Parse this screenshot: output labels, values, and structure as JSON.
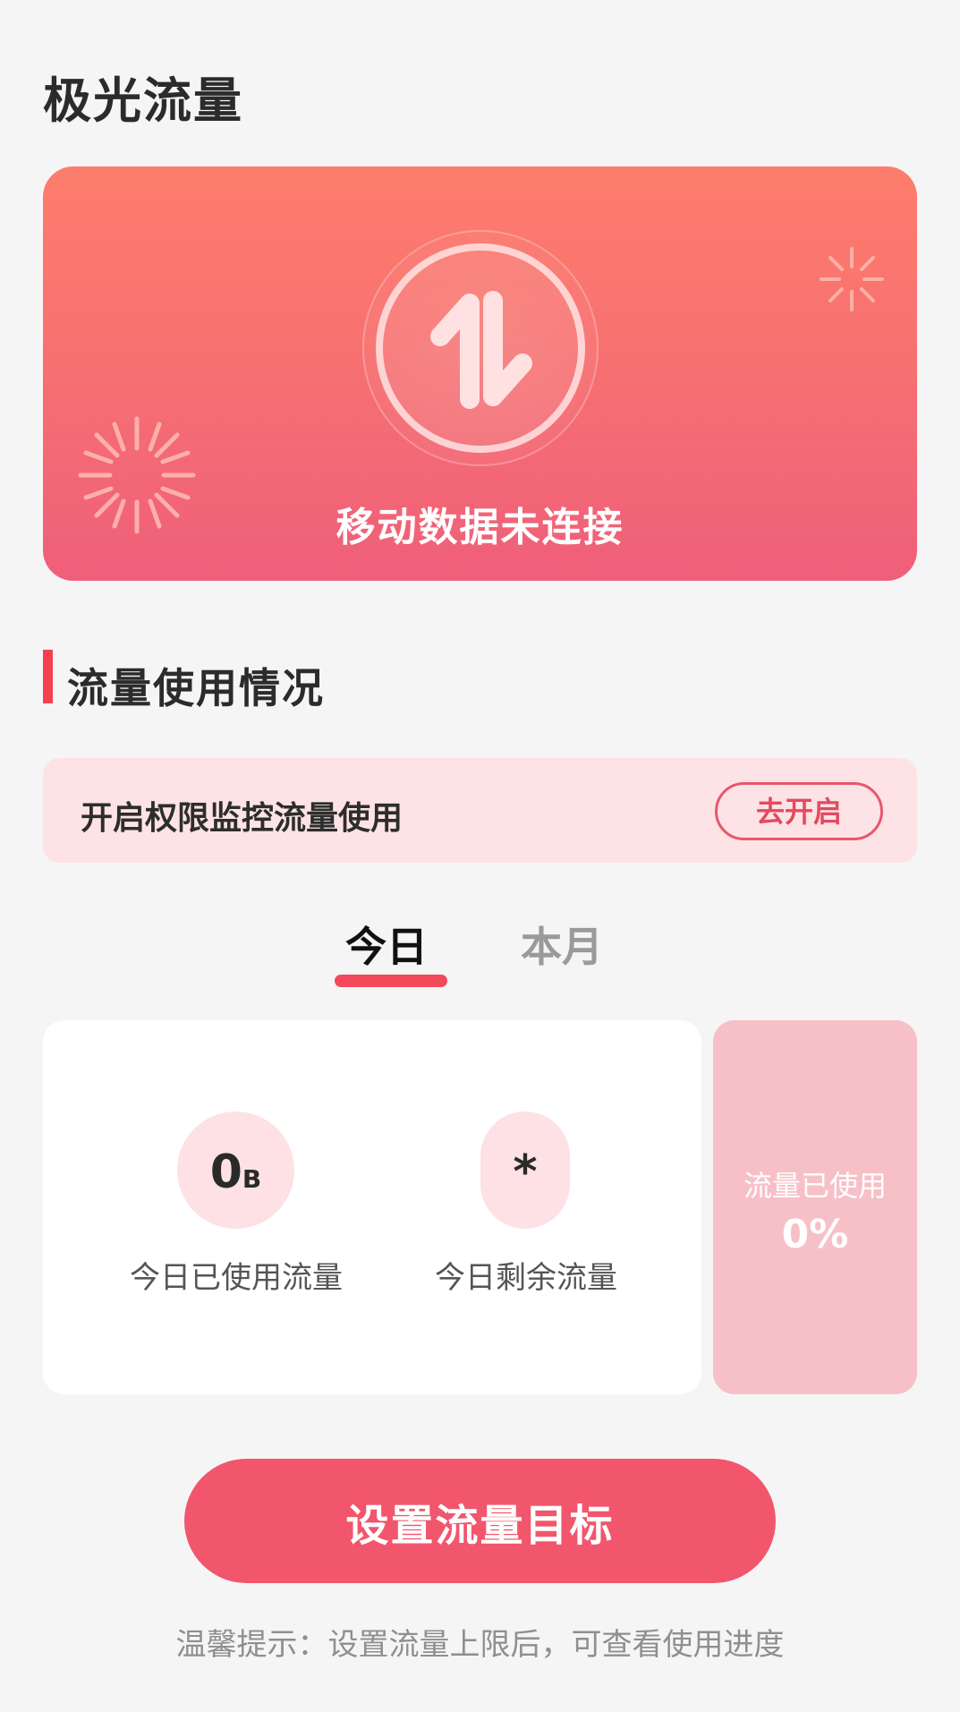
{
  "header": {
    "title": "极光流量"
  },
  "hero": {
    "status": "移动数据未连接",
    "icon": "data-transfer-arrows-icon",
    "accent": "#f36b72"
  },
  "section": {
    "title": "流量使用情况",
    "accent": "#f6404f"
  },
  "permission": {
    "text": "开启权限监控流量使用",
    "button": "去开启"
  },
  "tabs": [
    {
      "label": "今日",
      "active": true
    },
    {
      "label": "本月",
      "active": false
    }
  ],
  "stats": {
    "used_value": "0",
    "used_unit": "B",
    "used_label": "今日已使用流量",
    "remain_value": "*",
    "remain_label": "今日剩余流量",
    "percent_label": "流量已使用",
    "percent_value": "0%"
  },
  "cta": {
    "label": "设置流量目标",
    "color": "#f2566c"
  },
  "tip": "温馨提示：设置流量上限后，可查看使用进度"
}
